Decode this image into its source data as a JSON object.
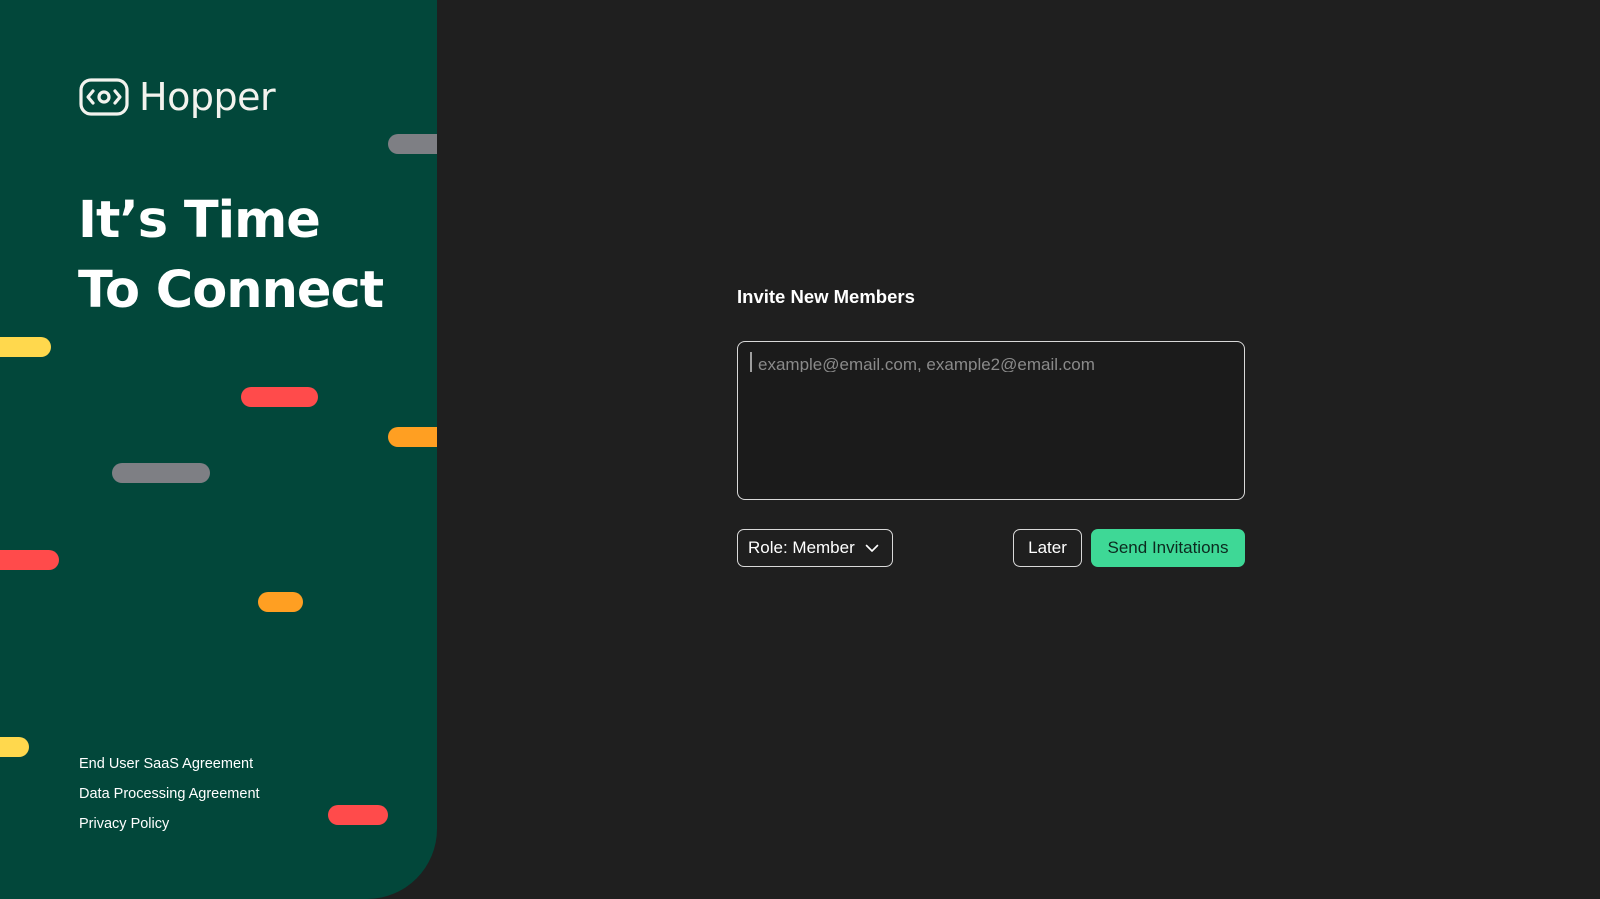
{
  "brand": {
    "name": "Hopper",
    "logo_icon": "hopper-logo-icon"
  },
  "hero": {
    "line1": "It’s Time",
    "line2": "To Connect"
  },
  "legal": {
    "links": [
      "End User SaaS Agreement",
      "Data Processing Agreement",
      "Privacy Policy"
    ]
  },
  "invite": {
    "title": "Invite New Members",
    "email_placeholder": "example@email.com, example2@email.com",
    "email_value": "",
    "role_label": "Role: Member",
    "role_icon": "chevron-down-icon",
    "later_label": "Later",
    "send_label": "Send Invitations"
  },
  "colors": {
    "background": "#1f1f1f",
    "panel": "#02473a",
    "accent_green": "#3ed896",
    "pill_yellow": "#ffd84d",
    "pill_red": "#ff4b4b",
    "pill_orange": "#ff9f22",
    "pill_gray": "#7e7f84"
  }
}
